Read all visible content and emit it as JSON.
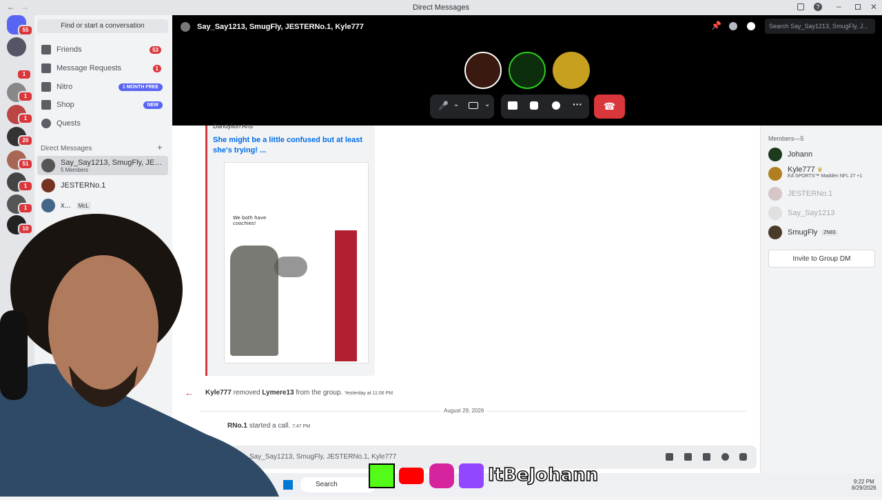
{
  "window": {
    "title": "Direct Messages"
  },
  "guild_badges": [
    "55",
    "1",
    "1",
    "1",
    "20",
    "51",
    "1",
    "1",
    "1",
    "10"
  ],
  "sidebar": {
    "find_placeholder": "Find or start a conversation",
    "nav": [
      {
        "label": "Friends",
        "badge": "53"
      },
      {
        "label": "Message Requests",
        "badge": "1"
      },
      {
        "label": "Nitro",
        "pill": "1 MONTH FREE"
      },
      {
        "label": "Shop",
        "pill": "NEW"
      },
      {
        "label": "Quests"
      }
    ],
    "dm_header": "Direct Messages",
    "dms": [
      {
        "name": "Say_Say1213, SmugFly, JESTER...",
        "sub": "5 Members"
      },
      {
        "name": "JESTERNo.1",
        "sub": ""
      },
      {
        "name": "x...",
        "sub": "McL"
      }
    ]
  },
  "call": {
    "title": "Say_Say1213, SmugFly, JESTERNo.1, Kyle777",
    "search_placeholder": "Search Say_Say1213, SmugFly, J..."
  },
  "chat": {
    "embed_provider": "Dandylion Arts",
    "embed_title": "She might be a little confused but at least she's trying! ...",
    "comic_text": "We both have coochies!",
    "sys1_user": "Kyle777",
    "sys1_action": "removed",
    "sys1_target": "Lymere13",
    "sys1_tail": "from the group.",
    "sys1_time": "Yesterday at 11:06 PM",
    "date_divider": "August 29, 2026",
    "sys2_user": "RNo.1",
    "sys2_action": "started a call.",
    "sys2_time": "7:47 PM",
    "composer_placeholder": "Say_Say1213, SmugFly, JESTERNo.1, Kyle777"
  },
  "members": {
    "header": "Members—5",
    "list": [
      {
        "name": "Johann",
        "status": ""
      },
      {
        "name": "Kyle777",
        "status": "EA SPORTS™ Madden NFL 27 +1"
      },
      {
        "name": "JESTERNo.1",
        "status": ""
      },
      {
        "name": "Say_Say1213",
        "status": ""
      },
      {
        "name": "SmugFly",
        "status": "ZN83"
      }
    ],
    "invite_label": "Invite to Group DM"
  },
  "overlay": {
    "handle": "ItBeJohann"
  },
  "taskbar": {
    "search": "Search",
    "time": "9:22 PM",
    "date": "8/29/2026"
  }
}
